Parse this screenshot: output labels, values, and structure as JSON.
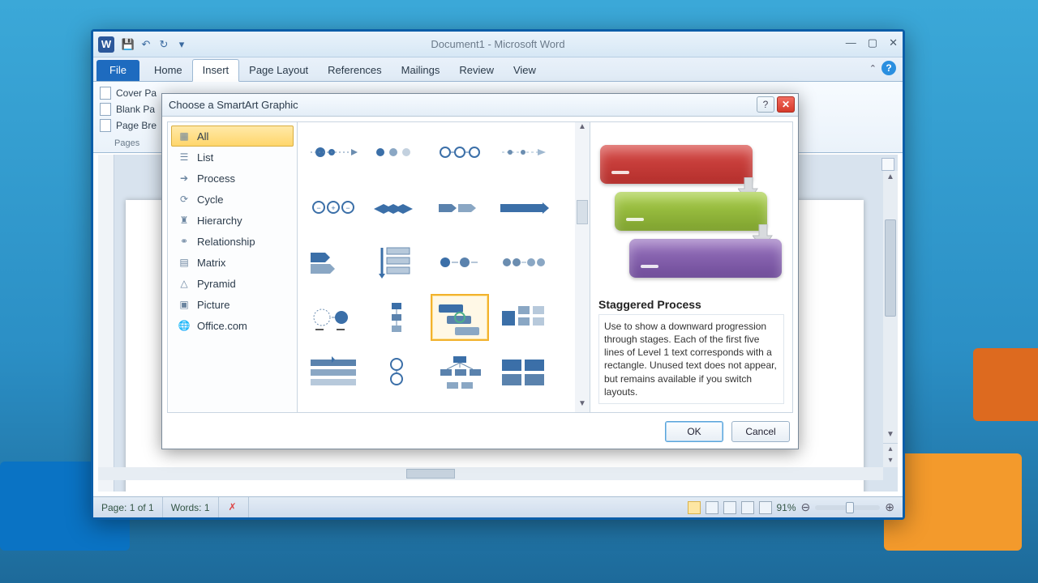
{
  "window": {
    "title": "Document1 - Microsoft Word",
    "qat": {
      "save": "💾",
      "undo": "↶",
      "redo": "↻"
    },
    "controls": {
      "min": "—",
      "max": "▢",
      "close": "✕"
    }
  },
  "tabs": {
    "file": "File",
    "home": "Home",
    "insert": "Insert",
    "pagelayout": "Page Layout",
    "references": "References",
    "mailings": "Mailings",
    "review": "Review",
    "view": "View"
  },
  "ribbon": {
    "cover_page": "Cover Pa",
    "blank_page": "Blank Pa",
    "page_break": "Page Bre",
    "group_label": "Pages"
  },
  "statusbar": {
    "page": "Page: 1 of 1",
    "words": "Words: 1",
    "zoom": "91%"
  },
  "dialog": {
    "title": "Choose a SmartArt Graphic",
    "categories": {
      "all": "All",
      "list": "List",
      "process": "Process",
      "cycle": "Cycle",
      "hierarchy": "Hierarchy",
      "relationship": "Relationship",
      "matrix": "Matrix",
      "pyramid": "Pyramid",
      "picture": "Picture",
      "office": "Office.com"
    },
    "preview": {
      "title": "Staggered Process",
      "desc": "Use to show a downward progression through stages. Each of the first five lines of Level 1 text corresponds with a rectangle. Unused text does not appear, but remains available if you switch layouts."
    },
    "buttons": {
      "ok": "OK",
      "cancel": "Cancel"
    }
  }
}
